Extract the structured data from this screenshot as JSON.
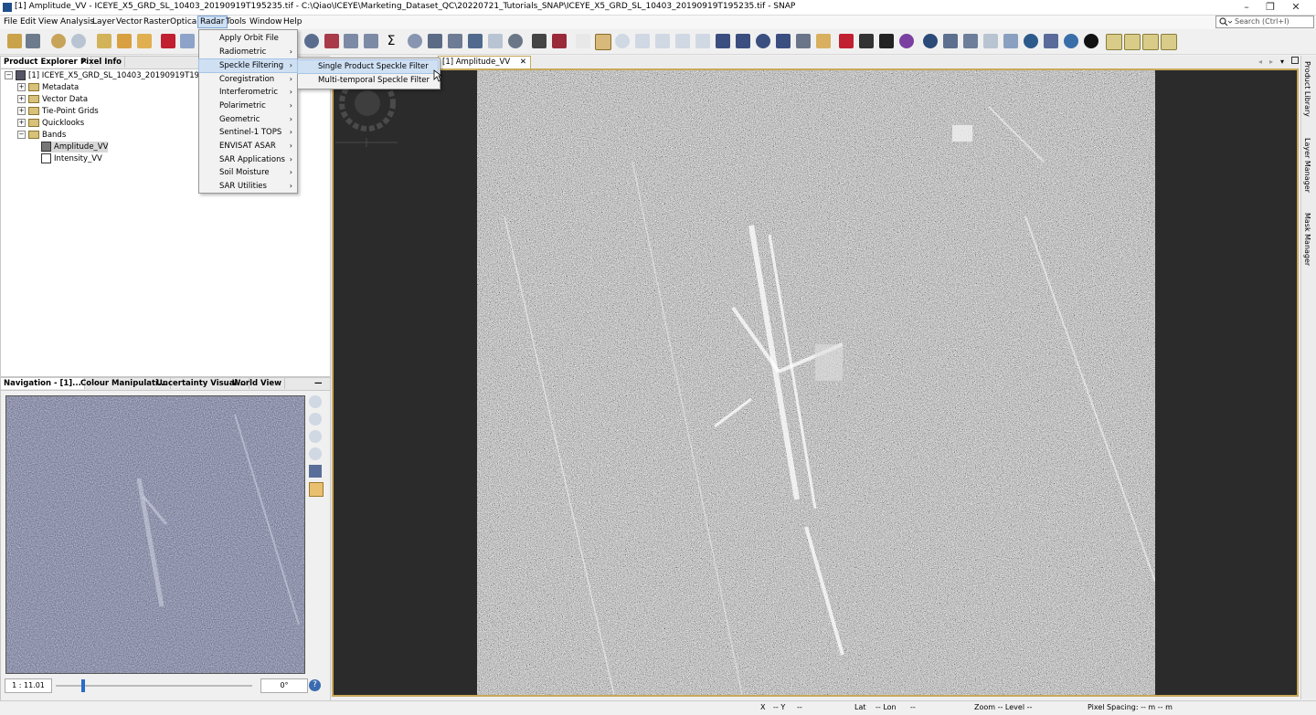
{
  "window": {
    "title": "[1] Amplitude_VV - ICEYE_X5_GRD_SL_10403_20190919T195235.tif - C:\\Qiao\\ICEYE\\Marketing_Dataset_QC\\20220721_Tutorials_SNAP\\ICEYE_X5_GRD_SL_10403_20190919T195235.tif - SNAP",
    "minimize": "–",
    "restore": "❐",
    "close": "✕"
  },
  "menubar": [
    "File",
    "Edit",
    "View",
    "Analysis",
    "Layer",
    "Vector",
    "Raster",
    "Optical",
    "Radar",
    "Tools",
    "Window",
    "Help"
  ],
  "search": {
    "placeholder": "Search (Ctrl+I)"
  },
  "left_panel": {
    "tabs": [
      "Product Explorer",
      "Pixel Info"
    ],
    "tab_close": "✕",
    "product": "[1] ICEYE_X5_GRD_SL_10403_20190919T195235.tif",
    "nodes": [
      "Metadata",
      "Vector Data",
      "Tie-Point Grids",
      "Quicklooks",
      "Bands"
    ],
    "bands": [
      "Amplitude_VV",
      "Intensity_VV"
    ]
  },
  "nav_panel": {
    "tabs": [
      "Navigation - [1]...",
      "Colour Manipulati...",
      "Uncertainty Visual...",
      "World View"
    ],
    "minimize": "—",
    "scale": "1 : 11.01",
    "rotation": "0°",
    "help": "?"
  },
  "image_view": {
    "tab_label": "[1] Amplitude_VV",
    "tab_close": "✕"
  },
  "radar_menu": {
    "items": [
      "Apply Orbit File",
      "Radiometric",
      "Speckle Filtering",
      "Coregistration",
      "Interferometric",
      "Polarimetric",
      "Geometric",
      "Sentinel-1 TOPS",
      "ENVISAT ASAR",
      "SAR Applications",
      "Soil Moisture",
      "SAR Utilities"
    ],
    "submenu_arrow": "›"
  },
  "speckle_submenu": {
    "items": [
      "Single Product Speckle Filter",
      "Multi-temporal Speckle Filter"
    ]
  },
  "right_side": [
    "Product Library",
    "Layer Manager",
    "Mask Manager"
  ],
  "statusbar": {
    "x": "X",
    "x_val": "-- Y",
    "y_val": "--",
    "lat": "Lat",
    "lat_val": "-- Lon",
    "lon_val": "--",
    "zoom": "Zoom -- Level --",
    "spacing": "Pixel Spacing: -- m -- m"
  },
  "colors": {
    "accent": "#cfe0f3",
    "viewport_border": "#c8a85a"
  }
}
